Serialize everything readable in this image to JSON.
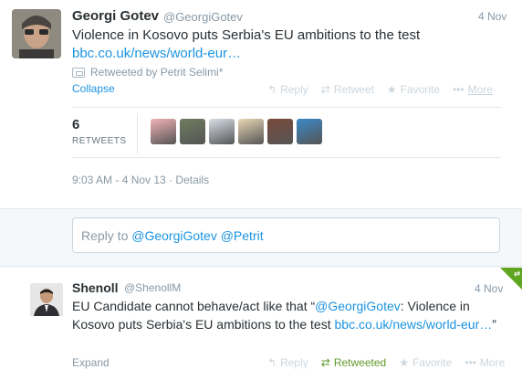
{
  "tweet1": {
    "name": "Georgi Gotev",
    "handle": "@GeorgiGotev",
    "date": "4 Nov",
    "text": "Violence in Kosovo puts Serbia's EU ambitions to the test",
    "link": "bbc.co.uk/news/world-eur…",
    "retweeted_by": "Retweeted by Petrit Selimi*",
    "collapse_label": "Collapse",
    "actions": {
      "reply": "Reply",
      "retweet": "Retweet",
      "favorite": "Favorite",
      "more": "More"
    },
    "retweets_count": "6",
    "retweets_label": "RETWEETS",
    "retweeter_colors": [
      "#f2b3b6",
      "#6e7d5f",
      "#d8e0e8",
      "#e9d7b5",
      "#7a4a3a",
      "#3b89c7"
    ],
    "timestamp": "9:03 AM - 4 Nov 13",
    "details_label": "Details"
  },
  "reply_box": {
    "prefix": "Reply to ",
    "mentions": "@GeorgiGotev @Petrit"
  },
  "tweet2": {
    "name": "Shenoll",
    "handle": "@ShenollM",
    "date": "4 Nov",
    "text_start": "EU Candidate cannot behave/act like that “",
    "mention": "@GeorgiGotev",
    "text_mid": ": Violence in Kosovo puts Serbia's EU ambitions to the test ",
    "link": "bbc.co.uk/news/world-eur…",
    "text_end": "”",
    "expand_label": "Expand",
    "actions": {
      "reply": "Reply",
      "retweeted": "Retweeted",
      "favorite": "Favorite",
      "more": "More"
    }
  },
  "colors": {
    "link": "#1c94e0",
    "retweeted": "#609928",
    "muted": "#8899a6"
  }
}
